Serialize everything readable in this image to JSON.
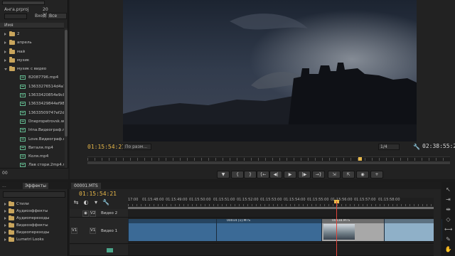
{
  "project": {
    "search_value": "",
    "project_name": "Анга.prproj",
    "item_count": "20 элементов",
    "find_field_value": "",
    "find_label": "Вход:",
    "find_scope": "Все",
    "column_name": "Имя",
    "items": [
      {
        "label": "2",
        "type": "folder",
        "indent": 0,
        "expanded": false
      },
      {
        "label": "апрель",
        "type": "folder",
        "indent": 0,
        "expanded": false
      },
      {
        "label": "май",
        "type": "folder",
        "indent": 0,
        "expanded": false
      },
      {
        "label": "музик",
        "type": "folder",
        "indent": 0,
        "expanded": false
      },
      {
        "label": "музик с видео",
        "type": "folder",
        "indent": 0,
        "expanded": true
      },
      {
        "label": "82087796.mp4",
        "type": "clip",
        "indent": 1
      },
      {
        "label": "13633276514d4a7a",
        "type": "clip",
        "indent": 1
      },
      {
        "label": "13633420854e9c8d",
        "type": "clip",
        "indent": 1
      },
      {
        "label": "13633429844ef983",
        "type": "clip",
        "indent": 1
      },
      {
        "label": "13633509747ef2d",
        "type": "clip",
        "indent": 1
      },
      {
        "label": "Dnepropetrovsk.w",
        "type": "clip",
        "indent": 1
      },
      {
        "label": "Irina.Видеограф.m",
        "type": "clip",
        "indent": 1
      },
      {
        "label": "Love.Видеограф.m",
        "type": "clip",
        "indent": 1
      },
      {
        "label": "Виталя.mp4",
        "type": "clip",
        "indent": 1
      },
      {
        "label": "Коля.mp4",
        "type": "clip",
        "indent": 1
      },
      {
        "label": "Лав стори.2mp4.m",
        "type": "clip",
        "indent": 1
      }
    ],
    "zoom_label": "00"
  },
  "monitor": {
    "timecode_current": "01:15:54:21",
    "fit_select": "По разм...",
    "resolution": "1/4",
    "timecode_duration": "02:38:55:21",
    "transport": [
      {
        "name": "marker-button",
        "glyph": "▼"
      },
      {
        "name": "mark-in-button",
        "glyph": "{"
      },
      {
        "name": "mark-out-button",
        "glyph": "}"
      },
      {
        "name": "go-to-in-button",
        "glyph": "{←"
      },
      {
        "name": "step-back-button",
        "glyph": "◀|"
      },
      {
        "name": "play-button",
        "glyph": "▶"
      },
      {
        "name": "step-forward-button",
        "glyph": "|▶"
      },
      {
        "name": "go-to-out-button",
        "glyph": "→}"
      },
      {
        "name": "insert-button",
        "glyph": "⇲"
      },
      {
        "name": "overwrite-button",
        "glyph": "⇱"
      },
      {
        "name": "export-frame-button",
        "glyph": "◉"
      },
      {
        "name": "add-button",
        "glyph": "+"
      }
    ]
  },
  "effects": {
    "tabs": [
      "...",
      "Эффекты"
    ],
    "categories": [
      "Стили",
      "Аудиоэффекты",
      "Аудиопереходы",
      "Видеоэффекты",
      "Видеопереходы",
      "Lumetri Looks"
    ]
  },
  "timeline": {
    "sequence_tab": "00001.MTS",
    "timecode": "01:15:54:21",
    "ruler_labels": [
      "17:00",
      "01:15:48:00",
      "01:15:49:00",
      "01:15:50:00",
      "01:15:51:00",
      "01:15:52:00",
      "01:15:53:00",
      "01:15:54:00",
      "01:15:55:00",
      "01:15:56:00",
      "01:15:57:00",
      "01:15:58:00"
    ],
    "tracks": {
      "v2": {
        "target": "V2",
        "name": "Видео 2"
      },
      "v1": {
        "source": "V1",
        "target": "V1",
        "name": "Видео 1"
      }
    },
    "clips": [
      {
        "label": "",
        "color": "#3b6a96"
      },
      {
        "label": "00014 [1].MTS",
        "color": "#3b6a96"
      },
      {
        "label": "00138.MTS",
        "color": "#a8a8a8"
      },
      {
        "label": "",
        "color": "#8fb0c8"
      },
      {
        "label": "00090.MTS",
        "color": "#5a7d9e"
      }
    ]
  },
  "colors": {
    "accent_timecode": "#e8b84a",
    "playhead": "#e0443a",
    "clip_blue": "#3b6a96",
    "folder": "#c9a55c",
    "clip_icon": "#63b98f"
  }
}
